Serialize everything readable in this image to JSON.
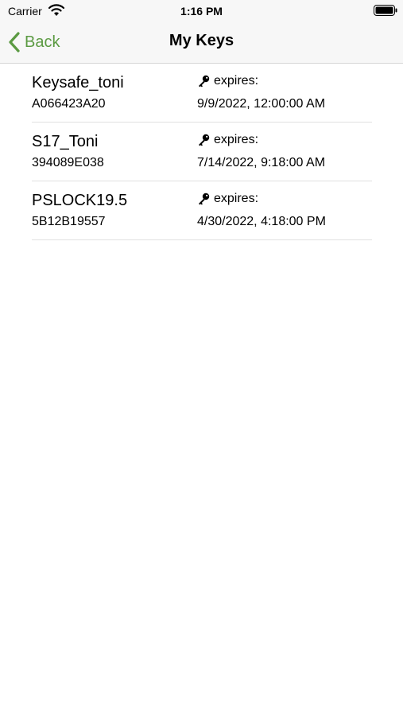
{
  "status_bar": {
    "carrier": "Carrier",
    "time": "1:16 PM",
    "icons": [
      "wifi-icon",
      "battery-icon"
    ]
  },
  "nav": {
    "back_label": "Back",
    "title": "My Keys",
    "accent_color": "#5b9a42"
  },
  "keys": [
    {
      "name": "Keysafe_toni",
      "serial": "A066423A20",
      "expires_label": "expires:",
      "expires": "9/9/2022, 12:00:00 AM"
    },
    {
      "name": "S17_Toni",
      "serial": "394089E038",
      "expires_label": "expires:",
      "expires": "7/14/2022, 9:18:00 AM"
    },
    {
      "name": "PSLOCK19.5",
      "serial": "5B12B19557",
      "expires_label": "expires:",
      "expires": "4/30/2022, 4:18:00 PM"
    }
  ]
}
